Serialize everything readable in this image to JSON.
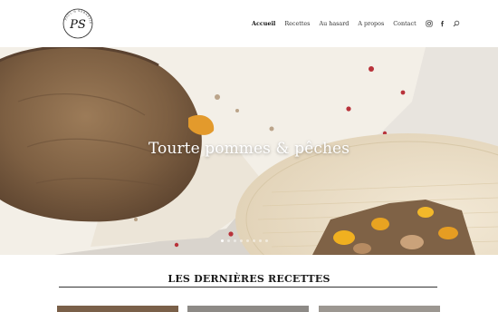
{
  "header": {
    "logo": {
      "monogram": "PS",
      "ring_text": "PAUL & SEBASTIEN"
    },
    "nav": [
      {
        "label": "Accueil",
        "active": true
      },
      {
        "label": "Recettes",
        "active": false
      },
      {
        "label": "Au hasard",
        "active": false
      },
      {
        "label": "A propos",
        "active": false
      },
      {
        "label": "Contact",
        "active": false
      }
    ],
    "icons": [
      "instagram-icon",
      "facebook-icon",
      "search-icon"
    ]
  },
  "hero": {
    "title": "Tourte pommes & pêches",
    "slide_count": 8,
    "active_slide": 1
  },
  "recent": {
    "title": "LES DERNIÈRES RECETTES",
    "card_count": 3
  },
  "colors": {
    "text": "#333333",
    "nav_active": "#111111",
    "hero_title": "#ffffff",
    "pastry": "#8a6a4a",
    "plate": "#efe3cc",
    "cloth": "#f1ede6"
  }
}
